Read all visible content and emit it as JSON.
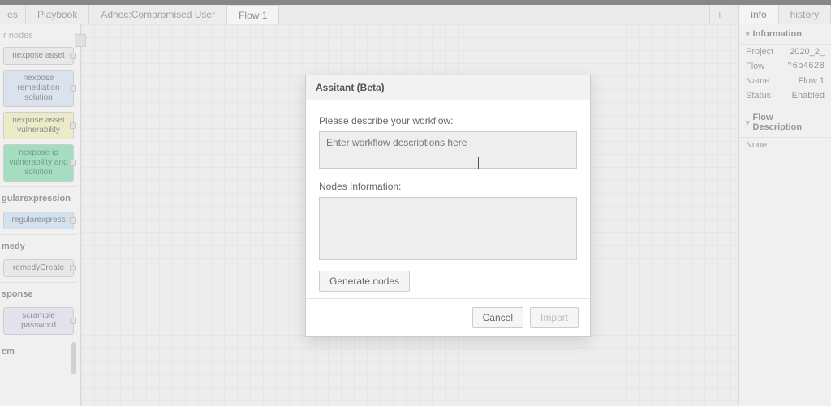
{
  "tabs": {
    "first": "es",
    "items": [
      "Playbook",
      "Adhoc:Compromised User",
      "Flow 1"
    ],
    "active_index": 2,
    "add_symbol": "+"
  },
  "right_tabs": {
    "items": [
      "info",
      "history"
    ],
    "active_index": 0
  },
  "palette": {
    "header": "r nodes",
    "nodes_top": [
      {
        "label": "nexpose asset",
        "cls": "n-gray"
      },
      {
        "label": "nexpose remediation solution",
        "cls": "n-blue"
      },
      {
        "label": "nexpose asset vulnerability",
        "cls": "n-yellow"
      },
      {
        "label": "nexpose ip vulnerability and solution",
        "cls": "n-green"
      }
    ],
    "groups": [
      {
        "title": "gularexpression",
        "nodes": [
          {
            "label": "regularexpress",
            "cls": "n-lblue"
          }
        ]
      },
      {
        "title": "medy",
        "nodes": [
          {
            "label": "remedyCreate",
            "cls": "n-gray"
          }
        ]
      },
      {
        "title": "sponse",
        "nodes": [
          {
            "label": "scramble password",
            "cls": "n-lav"
          }
        ]
      },
      {
        "title": "cm",
        "nodes": []
      }
    ]
  },
  "sidebar": {
    "section1_title": "Information",
    "rows": [
      {
        "key": "Project",
        "val": "2020_2_"
      },
      {
        "key": "Flow",
        "val": "\"6b4628",
        "mono": true
      },
      {
        "key": "Name",
        "val": "Flow 1"
      },
      {
        "key": "Status",
        "val": "Enabled"
      }
    ],
    "section2_title": "Flow Description",
    "description": "None"
  },
  "modal": {
    "title": "Assitant (Beta)",
    "workflow_label": "Please describe your workflow:",
    "workflow_placeholder": "Enter workflow descriptions here",
    "workflow_value": "",
    "nodes_label": "Nodes Information:",
    "nodes_value": "",
    "generate_label": "Generate nodes",
    "cancel_label": "Cancel",
    "import_label": "Import"
  }
}
